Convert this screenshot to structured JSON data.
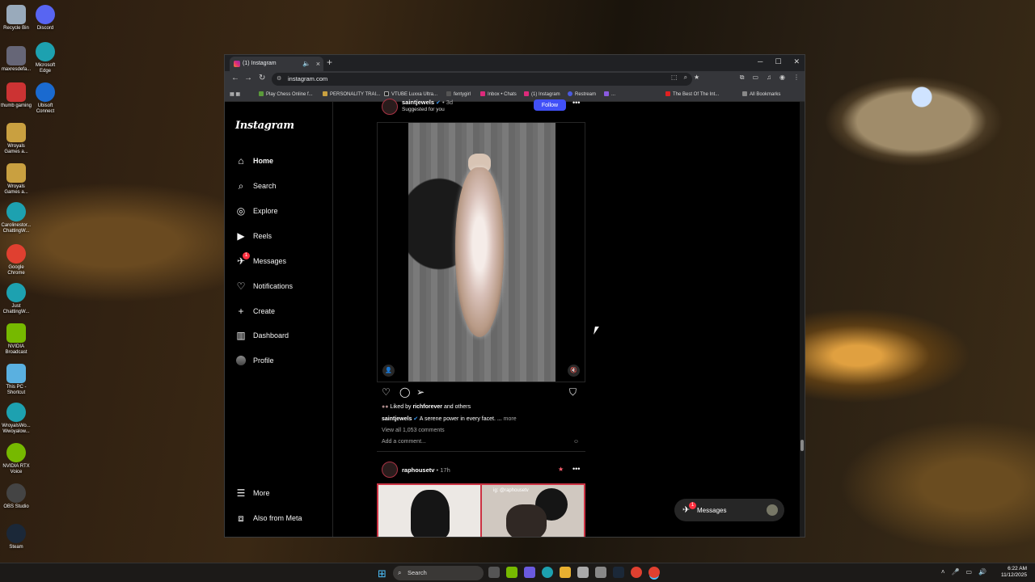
{
  "desktop": {
    "icons": [
      {
        "label": "Recycle Bin",
        "color": "#9ab"
      },
      {
        "label": "Discord",
        "color": "#5865f2"
      },
      {
        "label": "maxresdefa...",
        "color": "#667"
      },
      {
        "label": "Microsoft Edge",
        "color": "#1da1b0"
      },
      {
        "label": "thumb gaming",
        "color": "#c33"
      },
      {
        "label": "Ubisoft Connect",
        "color": "#1a6ad0"
      },
      {
        "label": "Wroyals Games a...",
        "color": "#c9a040"
      },
      {
        "label": "Wroyals Games a...",
        "color": "#c9a040"
      },
      {
        "label": "Carolinestor... ChattingW...",
        "color": "#1da1b0"
      },
      {
        "label": "Google Chrome",
        "color": "#e04030"
      },
      {
        "label": "Just ChattingW...",
        "color": "#1da1b0"
      },
      {
        "label": "NVIDIA Broadcast",
        "color": "#76b900"
      },
      {
        "label": "This PC - Shortcut",
        "color": "#5ab0e0"
      },
      {
        "label": "WroyalsWo... Wwoyalow...",
        "color": "#1da1b0"
      },
      {
        "label": "NVIDIA RTX Voice",
        "color": "#76b900"
      },
      {
        "label": "OBS Studio",
        "color": "#444"
      },
      {
        "label": "Steam",
        "color": "#1b2838"
      }
    ]
  },
  "browser": {
    "tab_title": "(1) Instagram",
    "url": "instagram.com",
    "bookmarks": [
      {
        "label": "Play Chess Online f...",
        "color": "#5a9a3a"
      },
      {
        "label": "PERSONALITY TRAI...",
        "color": "#c9a040"
      },
      {
        "label": "VTUBE Luxxa Ultra...",
        "color": "#222"
      },
      {
        "label": "fentygirl",
        "color": "#555"
      },
      {
        "label": "Inbox • Chats",
        "color": "#dd2a7b"
      },
      {
        "label": "(1) Instagram",
        "color": "#dd2a7b"
      },
      {
        "label": "Restream",
        "color": "#4a5ae0"
      },
      {
        "label": "...",
        "color": "#8a5ae0"
      },
      {
        "label": "The Best Of The Int...",
        "color": "#e02020"
      },
      {
        "label": "All Bookmarks",
        "color": "#888"
      }
    ]
  },
  "instagram": {
    "logo": "Instagram",
    "nav": {
      "home": "Home",
      "search": "Search",
      "explore": "Explore",
      "reels": "Reels",
      "messages": "Messages",
      "messages_badge": "1",
      "notifications": "Notifications",
      "create": "Create",
      "dashboard": "Dashboard",
      "profile": "Profile",
      "more": "More",
      "meta": "Also from Meta"
    },
    "post1": {
      "username": "saintjewels",
      "time": "• 3d",
      "subtitle": "Suggested for you",
      "follow": "Follow",
      "liked_prefix": "Liked by",
      "liked_user": "richforever",
      "liked_suffix": "and others",
      "caption_user": "saintjewels",
      "caption_text": "A serene power in every facet. ...",
      "caption_more": "more",
      "view_comments": "View all 1,053 comments",
      "add_comment": "Add a comment..."
    },
    "post2": {
      "username": "raphousetv",
      "time": "• 17h",
      "watermark": "ig: @raphousetv"
    },
    "messages_pill": {
      "label": "Messages",
      "badge": "1"
    }
  },
  "taskbar": {
    "search_placeholder": "Search",
    "time": "6:22 AM",
    "date": "11/12/2025"
  }
}
